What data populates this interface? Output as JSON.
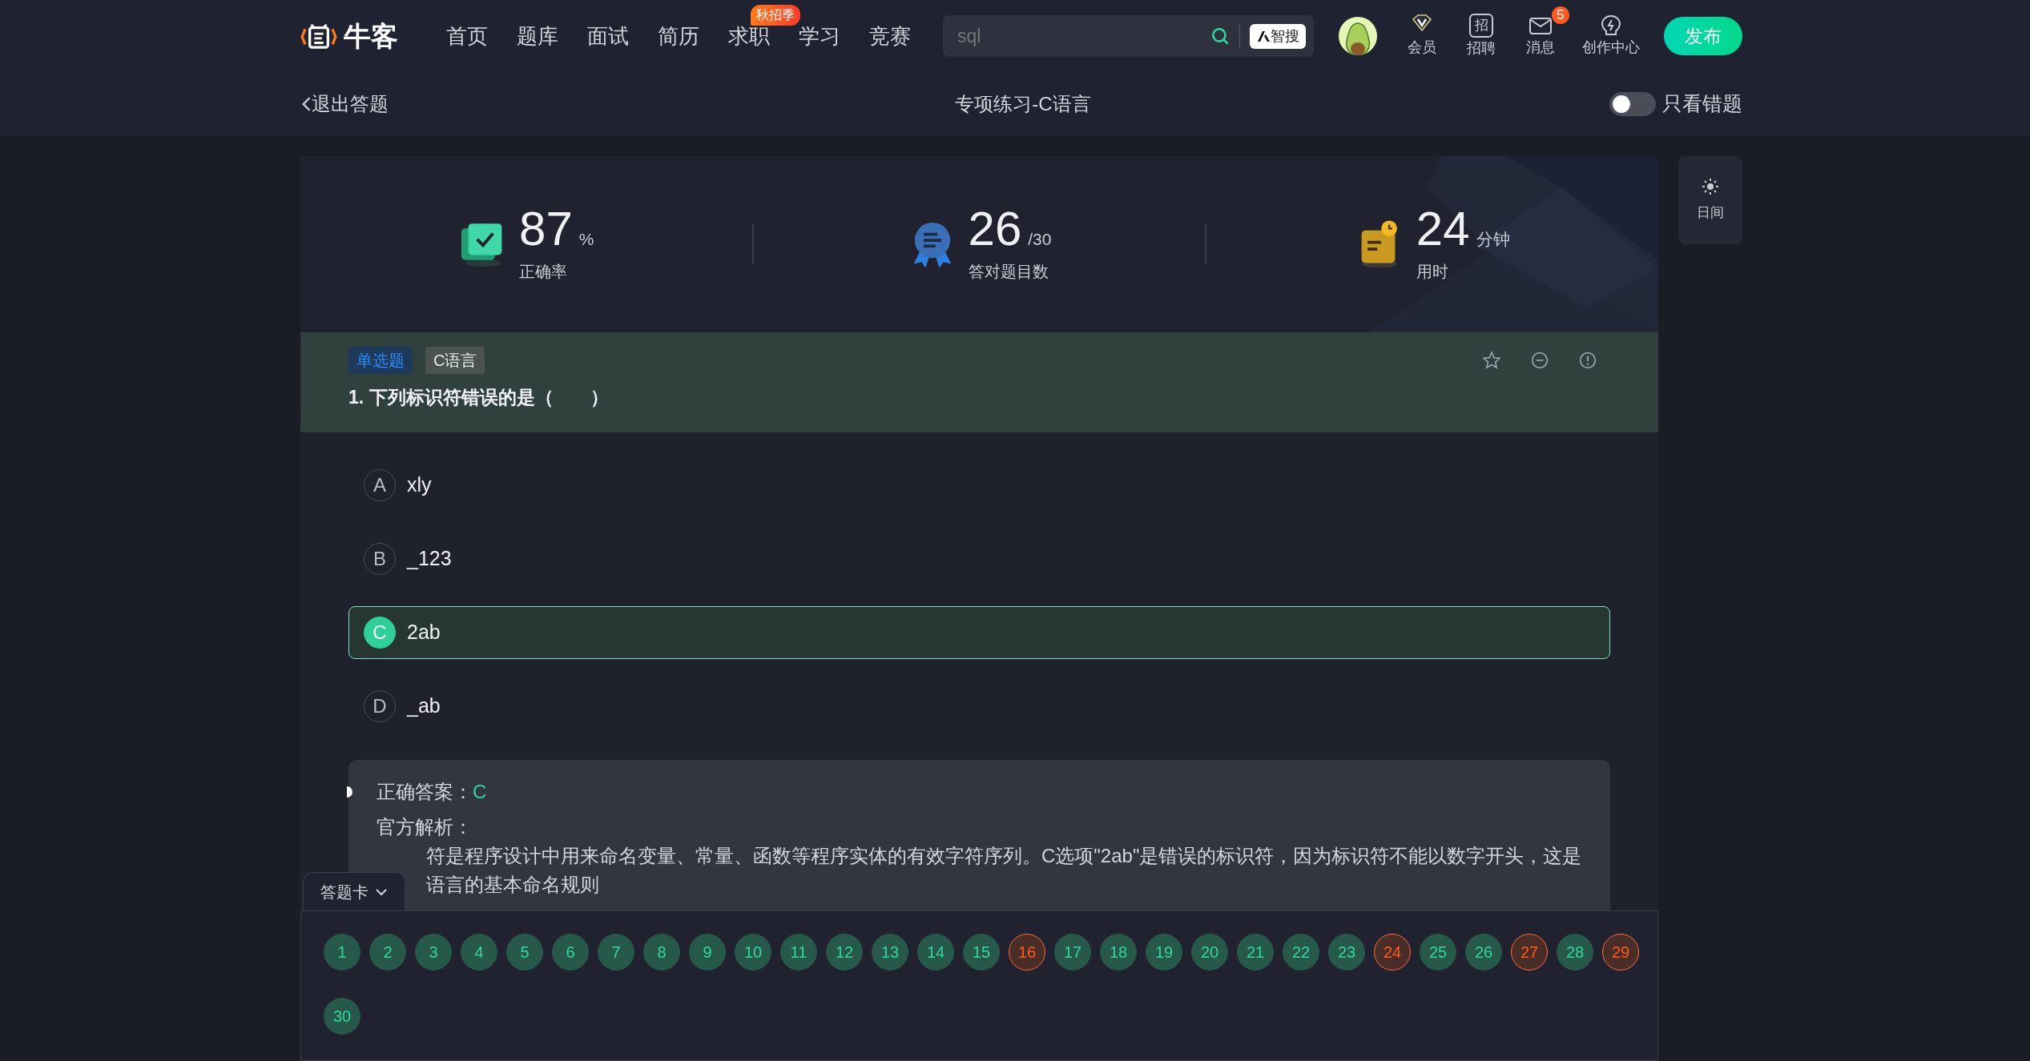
{
  "nav": {
    "logo": "牛客",
    "links": [
      {
        "label": "首页"
      },
      {
        "label": "题库"
      },
      {
        "label": "面试"
      },
      {
        "label": "简历"
      },
      {
        "label": "求职",
        "badge": "秋招季"
      },
      {
        "label": "学习"
      },
      {
        "label": "竞赛"
      }
    ],
    "search": {
      "placeholder": "sql"
    },
    "ai_button": "智搜",
    "icons": [
      {
        "label": "会员"
      },
      {
        "label": "招聘",
        "glyph": "招"
      },
      {
        "label": "消息",
        "badge": "5"
      },
      {
        "label": "创作中心"
      }
    ],
    "publish": "发布"
  },
  "subheader": {
    "back": "退出答题",
    "title": "专项练习-C语言",
    "toggle": {
      "label": "只看错题",
      "on": false
    }
  },
  "stats": [
    {
      "value": "87",
      "unit": "%",
      "label": "正确率"
    },
    {
      "value": "26",
      "unit": "/30",
      "label": "答对题目数"
    },
    {
      "value": "24",
      "unit": "分钟",
      "label": "用时"
    }
  ],
  "theme_button": "日间",
  "question": {
    "type": "单选题",
    "tag": "C语言",
    "text": "1. 下列标识符错误的是（　　）",
    "options": [
      {
        "letter": "A",
        "text": "xly",
        "selected": false
      },
      {
        "letter": "B",
        "text": "_123",
        "selected": false
      },
      {
        "letter": "C",
        "text": "2ab",
        "selected": true
      },
      {
        "letter": "D",
        "text": "_ab",
        "selected": false
      }
    ]
  },
  "analysis": {
    "answer_label": "正确答案：",
    "answer": "C",
    "heading": "官方解析：",
    "lines": [
      "符是程序设计中用来命名变量、常量、函数等程序实体的有效字符序列。C选项\"2ab\"是错误的标识符，因为标识符不能以数字开头，这是",
      "语言的基本命名规则"
    ]
  },
  "answer_card": {
    "label": "答题卡",
    "items": [
      {
        "number": "1",
        "wrong": false
      },
      {
        "number": "2",
        "wrong": false
      },
      {
        "number": "3",
        "wrong": false
      },
      {
        "number": "4",
        "wrong": false
      },
      {
        "number": "5",
        "wrong": false
      },
      {
        "number": "6",
        "wrong": false
      },
      {
        "number": "7",
        "wrong": false
      },
      {
        "number": "8",
        "wrong": false
      },
      {
        "number": "9",
        "wrong": false
      },
      {
        "number": "10",
        "wrong": false
      },
      {
        "number": "11",
        "wrong": false
      },
      {
        "number": "12",
        "wrong": false
      },
      {
        "number": "13",
        "wrong": false
      },
      {
        "number": "14",
        "wrong": false
      },
      {
        "number": "15",
        "wrong": false
      },
      {
        "number": "16",
        "wrong": true
      },
      {
        "number": "17",
        "wrong": false
      },
      {
        "number": "18",
        "wrong": false
      },
      {
        "number": "19",
        "wrong": false
      },
      {
        "number": "20",
        "wrong": false
      },
      {
        "number": "21",
        "wrong": false
      },
      {
        "number": "22",
        "wrong": false
      },
      {
        "number": "23",
        "wrong": false
      },
      {
        "number": "24",
        "wrong": true
      },
      {
        "number": "25",
        "wrong": false
      },
      {
        "number": "26",
        "wrong": false
      },
      {
        "number": "27",
        "wrong": true
      },
      {
        "number": "28",
        "wrong": false
      },
      {
        "number": "29",
        "wrong": true
      },
      {
        "number": "30",
        "wrong": false
      }
    ]
  }
}
